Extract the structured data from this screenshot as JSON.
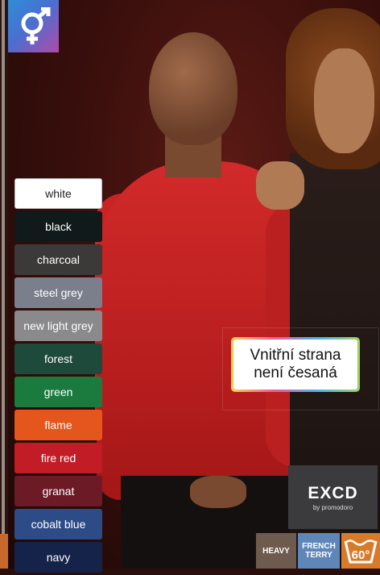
{
  "badge": {
    "icon": "male-female-symbol-icon"
  },
  "swatches": [
    {
      "label": "white",
      "color": "#ffffff"
    },
    {
      "label": "black",
      "color": "#111a1a"
    },
    {
      "label": "charcoal",
      "color": "#3b3a39"
    },
    {
      "label": "steel grey",
      "color": "#7b7f8c"
    },
    {
      "label": "new light grey",
      "color": "#8a8a8c"
    },
    {
      "label": "forest",
      "color": "#1e4a3c"
    },
    {
      "label": "green",
      "color": "#1b7a3e"
    },
    {
      "label": "flame",
      "color": "#e4561c"
    },
    {
      "label": "fire red",
      "color": "#c21c26"
    },
    {
      "label": "granat",
      "color": "#6b1a26"
    },
    {
      "label": "cobalt blue",
      "color": "#2d4b86"
    },
    {
      "label": "navy",
      "color": "#15234a"
    }
  ],
  "callout": {
    "line1": "Vnitřní strana",
    "line2": "není česaná"
  },
  "brand": {
    "logo": "EXCD",
    "sub": "by promodoro"
  },
  "tags": {
    "heavy": "HEAVY",
    "terry1": "FRENCH",
    "terry2": "TERRY",
    "temp": "60°"
  }
}
